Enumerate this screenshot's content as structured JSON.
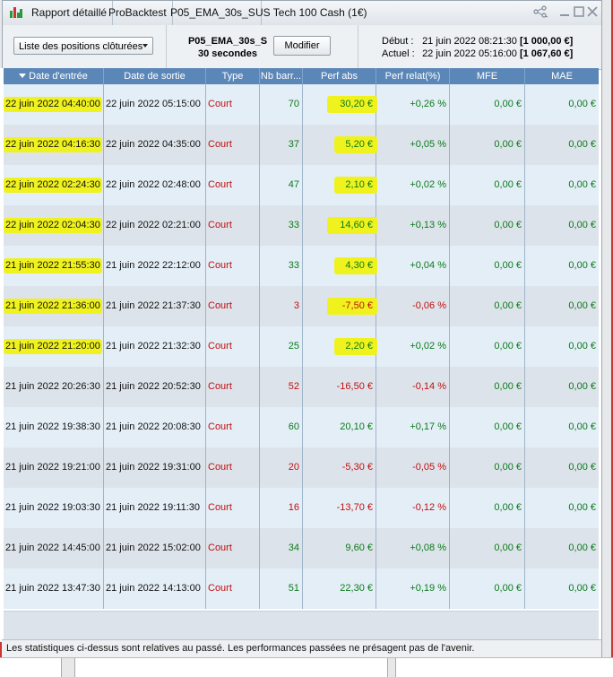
{
  "titlebar": {
    "tabs": [
      "Rapport détaillé",
      "ProBacktest",
      "P05_EMA_30s_S",
      "US Tech 100 Cash (1€)"
    ],
    "share_icon": "share-icon",
    "controls": [
      "minimize-icon",
      "maximize-icon",
      "close-icon"
    ]
  },
  "toolbar": {
    "dropdown_value": "Liste des positions clôturées",
    "strategy_name": "P05_EMA_30s_S",
    "strategy_period": "30 secondes",
    "modify_label": "Modifier",
    "start_label": "Début :",
    "start_date": "21 juin 2022 08:21:30",
    "start_value": "[1 000,00 €]",
    "current_label": "Actuel :",
    "current_date": "22 juin 2022 05:16:00",
    "current_value": "[1 067,60 €]"
  },
  "table": {
    "columns": [
      "Date d'entrée",
      "Date de sortie",
      "Type",
      "Nb barr...",
      "Perf abs",
      "Perf relat(%)",
      "MFE",
      "MAE"
    ],
    "rows": [
      {
        "entry": "22 juin 2022 04:40:00",
        "exit": "22 juin 2022 05:15:00",
        "type": "Court",
        "bars": "70",
        "perf_abs": "30,20 €",
        "perf_rel": "+0,26 %",
        "mfe": "0,00 €",
        "mae": "0,00 €",
        "positive": true,
        "highlight": true
      },
      {
        "entry": "22 juin 2022 04:16:30",
        "exit": "22 juin 2022 04:35:00",
        "type": "Court",
        "bars": "37",
        "perf_abs": "5,20 €",
        "perf_rel": "+0,05 %",
        "mfe": "0,00 €",
        "mae": "0,00 €",
        "positive": true,
        "highlight": true
      },
      {
        "entry": "22 juin 2022 02:24:30",
        "exit": "22 juin 2022 02:48:00",
        "type": "Court",
        "bars": "47",
        "perf_abs": "2,10 €",
        "perf_rel": "+0,02 %",
        "mfe": "0,00 €",
        "mae": "0,00 €",
        "positive": true,
        "highlight": true
      },
      {
        "entry": "22 juin 2022 02:04:30",
        "exit": "22 juin 2022 02:21:00",
        "type": "Court",
        "bars": "33",
        "perf_abs": "14,60 €",
        "perf_rel": "+0,13 %",
        "mfe": "0,00 €",
        "mae": "0,00 €",
        "positive": true,
        "highlight": true
      },
      {
        "entry": "21 juin 2022 21:55:30",
        "exit": "21 juin 2022 22:12:00",
        "type": "Court",
        "bars": "33",
        "perf_abs": "4,30 €",
        "perf_rel": "+0,04 %",
        "mfe": "0,00 €",
        "mae": "0,00 €",
        "positive": true,
        "highlight": true
      },
      {
        "entry": "21 juin 2022 21:36:00",
        "exit": "21 juin 2022 21:37:30",
        "type": "Court",
        "bars": "3",
        "perf_abs": "-7,50 €",
        "perf_rel": "-0,06 %",
        "mfe": "0,00 €",
        "mae": "0,00 €",
        "positive": false,
        "highlight": true
      },
      {
        "entry": "21 juin 2022 21:20:00",
        "exit": "21 juin 2022 21:32:30",
        "type": "Court",
        "bars": "25",
        "perf_abs": "2,20 €",
        "perf_rel": "+0,02 %",
        "mfe": "0,00 €",
        "mae": "0,00 €",
        "positive": true,
        "highlight": true
      },
      {
        "entry": "21 juin 2022 20:26:30",
        "exit": "21 juin 2022 20:52:30",
        "type": "Court",
        "bars": "52",
        "perf_abs": "-16,50 €",
        "perf_rel": "-0,14 %",
        "mfe": "0,00 €",
        "mae": "0,00 €",
        "positive": false,
        "highlight": false
      },
      {
        "entry": "21 juin 2022 19:38:30",
        "exit": "21 juin 2022 20:08:30",
        "type": "Court",
        "bars": "60",
        "perf_abs": "20,10 €",
        "perf_rel": "+0,17 %",
        "mfe": "0,00 €",
        "mae": "0,00 €",
        "positive": true,
        "highlight": false
      },
      {
        "entry": "21 juin 2022 19:21:00",
        "exit": "21 juin 2022 19:31:00",
        "type": "Court",
        "bars": "20",
        "perf_abs": "-5,30 €",
        "perf_rel": "-0,05 %",
        "mfe": "0,00 €",
        "mae": "0,00 €",
        "positive": false,
        "highlight": false
      },
      {
        "entry": "21 juin 2022 19:03:30",
        "exit": "21 juin 2022 19:11:30",
        "type": "Court",
        "bars": "16",
        "perf_abs": "-13,70 €",
        "perf_rel": "-0,12 %",
        "mfe": "0,00 €",
        "mae": "0,00 €",
        "positive": false,
        "highlight": false
      },
      {
        "entry": "21 juin 2022 14:45:00",
        "exit": "21 juin 2022 15:02:00",
        "type": "Court",
        "bars": "34",
        "perf_abs": "9,60 €",
        "perf_rel": "+0,08 %",
        "mfe": "0,00 €",
        "mae": "0,00 €",
        "positive": true,
        "highlight": false
      },
      {
        "entry": "21 juin 2022 13:47:30",
        "exit": "21 juin 2022 14:13:00",
        "type": "Court",
        "bars": "51",
        "perf_abs": "22,30 €",
        "perf_rel": "+0,19 %",
        "mfe": "0,00 €",
        "mae": "0,00 €",
        "positive": true,
        "highlight": false
      }
    ]
  },
  "footer": {
    "disclaimer": "Les statistiques ci-dessus sont relatives au passé. Les performances passées ne présagent pas de l'avenir."
  },
  "colors": {
    "header_bg": "#5b87b8",
    "row_light": "#e4eef7",
    "row_dark": "#dde3ea",
    "positive": "#0a7a1a",
    "negative": "#c01010",
    "type_text": "#c01010",
    "highlight": "#f0f21e"
  }
}
